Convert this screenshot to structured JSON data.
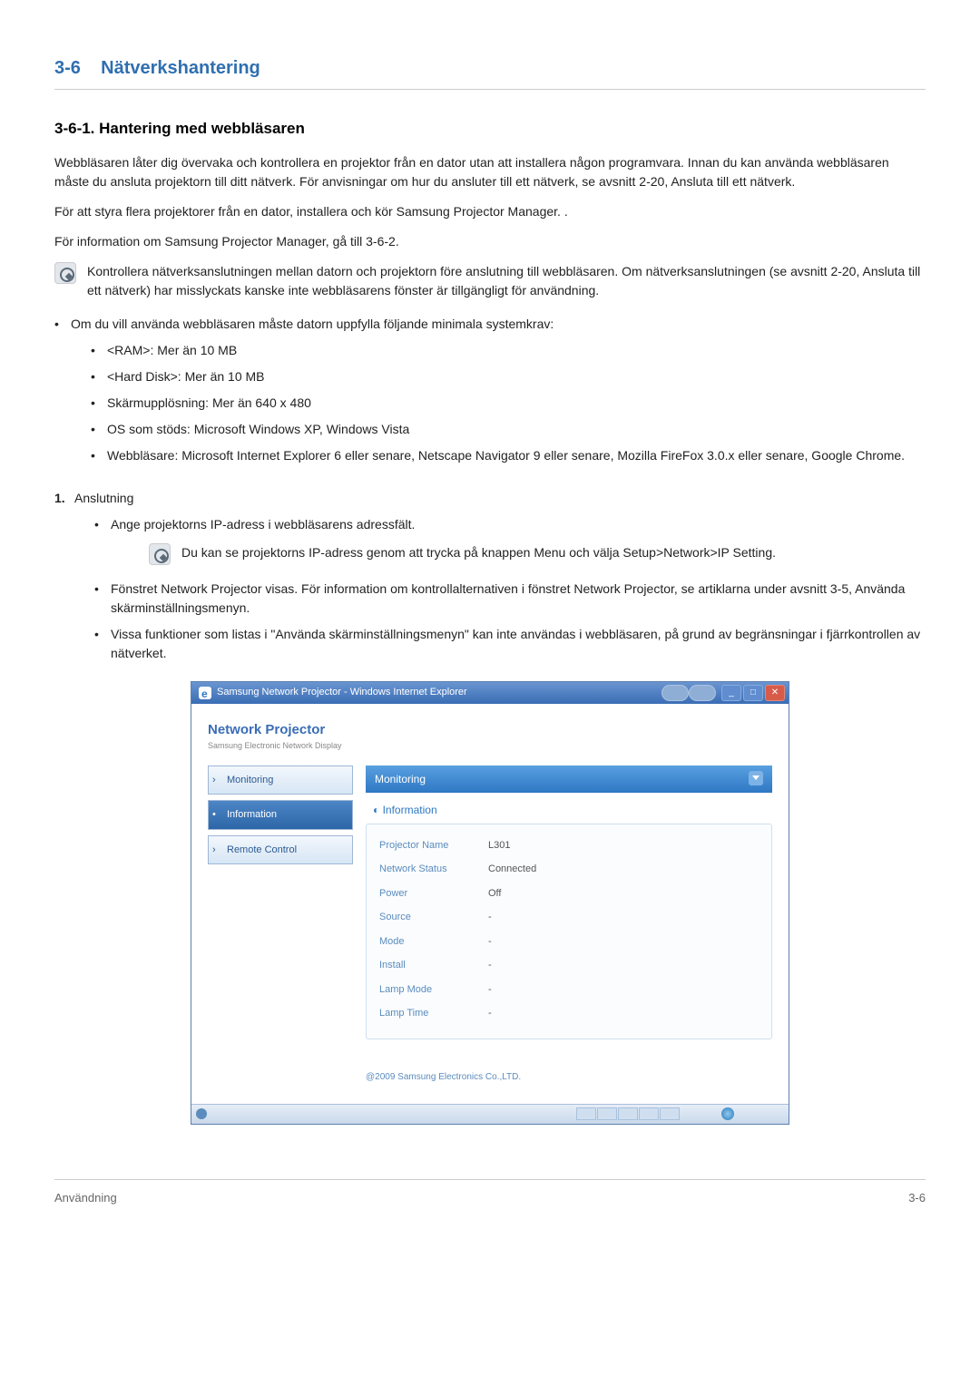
{
  "section_number": "3-6",
  "section_title": "Nätverkshantering",
  "subsection_title": "3-6-1. Hantering med webbläsaren",
  "paragraphs": {
    "intro": "Webbläsaren låter dig övervaka och kontrollera en projektor från en dator utan att installera någon programvara. Innan du kan använda webbläsaren måste du ansluta projektorn till ditt nätverk. För anvisningar om hur du ansluter till ett nätverk, se avsnitt 2-20, Ansluta till ett nätverk.",
    "p2": "För att styra flera projektorer från en dator, installera och kör Samsung Projector Manager. .",
    "p3": "För information om Samsung Projector Manager, gå till 3-6-2.",
    "note1": "Kontrollera nätverksanslutningen mellan datorn och projektorn före anslutning till webbläsaren. Om nätverksanslutningen (se avsnitt 2-20, Ansluta till ett nätverk) har misslyckats kanske inte webbläsarens fönster är tillgängligt för användning."
  },
  "req_intro": "Om du vill använda webbläsaren måste datorn uppfylla följande minimala systemkrav:",
  "reqs": [
    "<RAM>: Mer än 10 MB",
    "<Hard Disk>: Mer än 10 MB",
    "Skärmupplösning: Mer än 640 x 480",
    "OS som stöds: Microsoft Windows XP, Windows Vista",
    "Webbläsare: Microsoft Internet Explorer 6 eller senare, Netscape Navigator 9 eller senare, Mozilla FireFox 3.0.x eller senare, Google Chrome."
  ],
  "step1_title": "Anslutning",
  "step1_items": {
    "a": "Ange projektorns IP-adress i webbläsarens adressfält.",
    "a_note": "Du kan se projektorns IP-adress genom att trycka på knappen Menu och välja Setup>Network>IP Setting.",
    "b": "Fönstret Network Projector visas. För information om kontrollalternativen i fönstret Network Projector, se artiklarna under avsnitt 3-5, Använda skärminställningsmenyn.",
    "c": "Vissa funktioner som listas i \"Använda skärminställningsmenyn\" kan inte användas i webbläsaren, på grund av begränsningar i fjärrkontrollen av nätverket."
  },
  "screenshot": {
    "window_title": "Samsung Network Projector - Windows Internet Explorer",
    "app_title": "Network Projector",
    "app_subtitle": "Samsung Electronic Network Display",
    "sidebar": {
      "items": [
        "Monitoring",
        "Information",
        "Remote Control"
      ]
    },
    "main_header": "Monitoring",
    "info_header": "Information",
    "rows": [
      {
        "label": "Projector Name",
        "value": "L301"
      },
      {
        "label": "Network Status",
        "value": "Connected"
      },
      {
        "label": "Power",
        "value": "Off"
      },
      {
        "label": "Source",
        "value": "-"
      },
      {
        "label": "Mode",
        "value": "-"
      },
      {
        "label": "Install",
        "value": "-"
      },
      {
        "label": "Lamp Mode",
        "value": "-"
      },
      {
        "label": "Lamp Time",
        "value": "-"
      }
    ],
    "copyright": "@2009 Samsung Electronics Co.,LTD."
  },
  "footer_left": "Användning",
  "footer_right": "3-6"
}
